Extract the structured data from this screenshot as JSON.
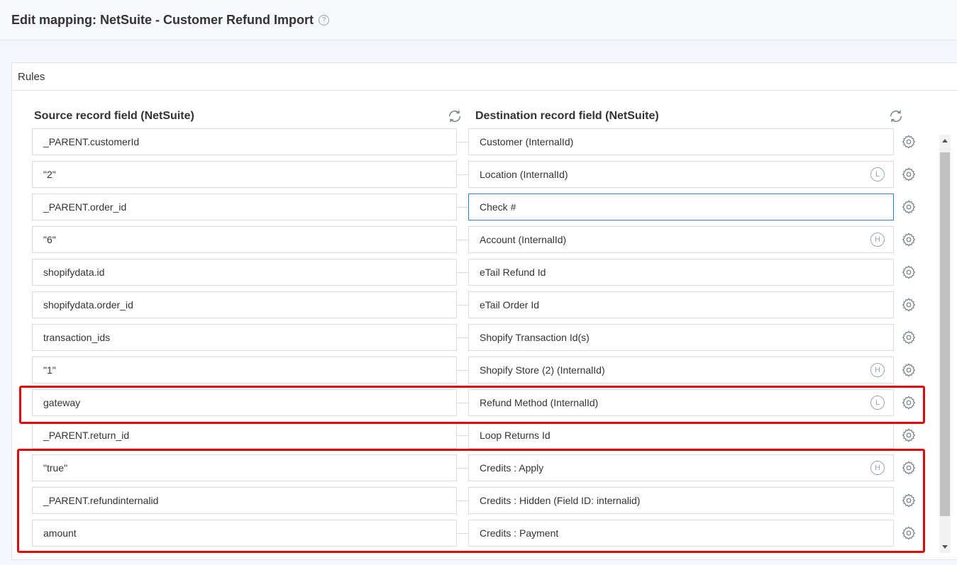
{
  "header": {
    "title": "Edit mapping: NetSuite - Customer Refund Import",
    "help_icon": "question-circle-icon"
  },
  "panel": {
    "title": "Rules",
    "source_header": "Source record field (NetSuite)",
    "destination_header": "Destination record field (NetSuite)"
  },
  "rows": [
    {
      "source": "_PARENT.customerId",
      "destination": "Customer (InternalId)",
      "badge": ""
    },
    {
      "source": "\"2\"",
      "destination": "Location (InternalId)",
      "badge": "L"
    },
    {
      "source": "_PARENT.order_id",
      "destination": "Check #",
      "badge": ""
    },
    {
      "source": "\"6\"",
      "destination": "Account (InternalId)",
      "badge": "H"
    },
    {
      "source": "shopifydata.id",
      "destination": "eTail Refund Id",
      "badge": ""
    },
    {
      "source": "shopifydata.order_id",
      "destination": "eTail Order Id",
      "badge": ""
    },
    {
      "source": "transaction_ids",
      "destination": "Shopify Transaction Id(s)",
      "badge": ""
    },
    {
      "source": "\"1\"",
      "destination": "Shopify Store (2) (InternalId)",
      "badge": "H"
    },
    {
      "source": "gateway",
      "destination": "Refund Method (InternalId)",
      "badge": "L"
    },
    {
      "source": "_PARENT.return_id",
      "destination": "Loop Returns Id",
      "badge": ""
    },
    {
      "source": "\"true\"",
      "destination": "Credits : Apply",
      "badge": "H"
    },
    {
      "source": "_PARENT.refundinternalid",
      "destination": "Credits : Hidden (Field ID: internalid)",
      "badge": ""
    },
    {
      "source": "amount",
      "destination": "Credits : Payment",
      "badge": ""
    }
  ],
  "colors": {
    "highlight": "#e3090a",
    "focus": "#3a7bd5"
  }
}
